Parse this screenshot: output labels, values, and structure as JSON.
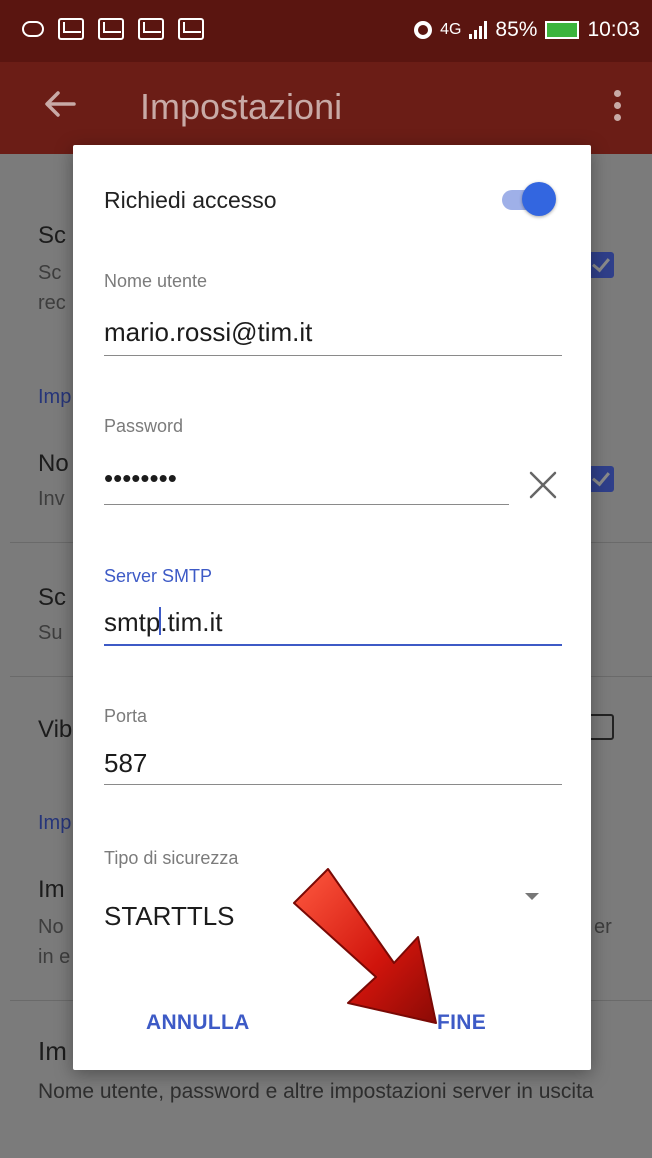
{
  "status_bar": {
    "network": "4G",
    "battery": "85%",
    "time": "10:03"
  },
  "app_bar": {
    "title": "Impostazioni"
  },
  "background": {
    "item1_title": "Sc",
    "item1_sub_line1": "Sc",
    "item1_sub_line2": "rec",
    "section1": "Imp",
    "item2_title": "No",
    "item2_sub": "Inv",
    "item3_title": "Sc",
    "item3_sub": "Su",
    "item4_title": "Vib",
    "section2": "Imp",
    "item5_title": "Im",
    "item5_sub_line1": "No",
    "item5_sub_line1_right": "er",
    "item5_sub_line2": "in e",
    "item6_title": "Im",
    "item6_sub": "Nome utente, password e altre impostazioni server in uscita"
  },
  "dialog": {
    "toggle_label": "Richiedi accesso",
    "toggle_on": true,
    "username": {
      "label": "Nome utente",
      "value": "mario.rossi@tim.it"
    },
    "password": {
      "label": "Password",
      "value": "••••••••"
    },
    "smtp": {
      "label": "Server SMTP",
      "value_before_caret": "smtp",
      "value_after_caret": ".tim.it"
    },
    "port": {
      "label": "Porta",
      "value": "587"
    },
    "security": {
      "label": "Tipo di sicurezza",
      "value": "STARTTLS"
    },
    "buttons": {
      "cancel": "ANNULLA",
      "done": "FINE"
    }
  },
  "colors": {
    "accent": "#3d5ac6",
    "toolbar": "#6b1d16",
    "status_bar": "#5a1510",
    "annotation_arrow": "#d0140c"
  }
}
